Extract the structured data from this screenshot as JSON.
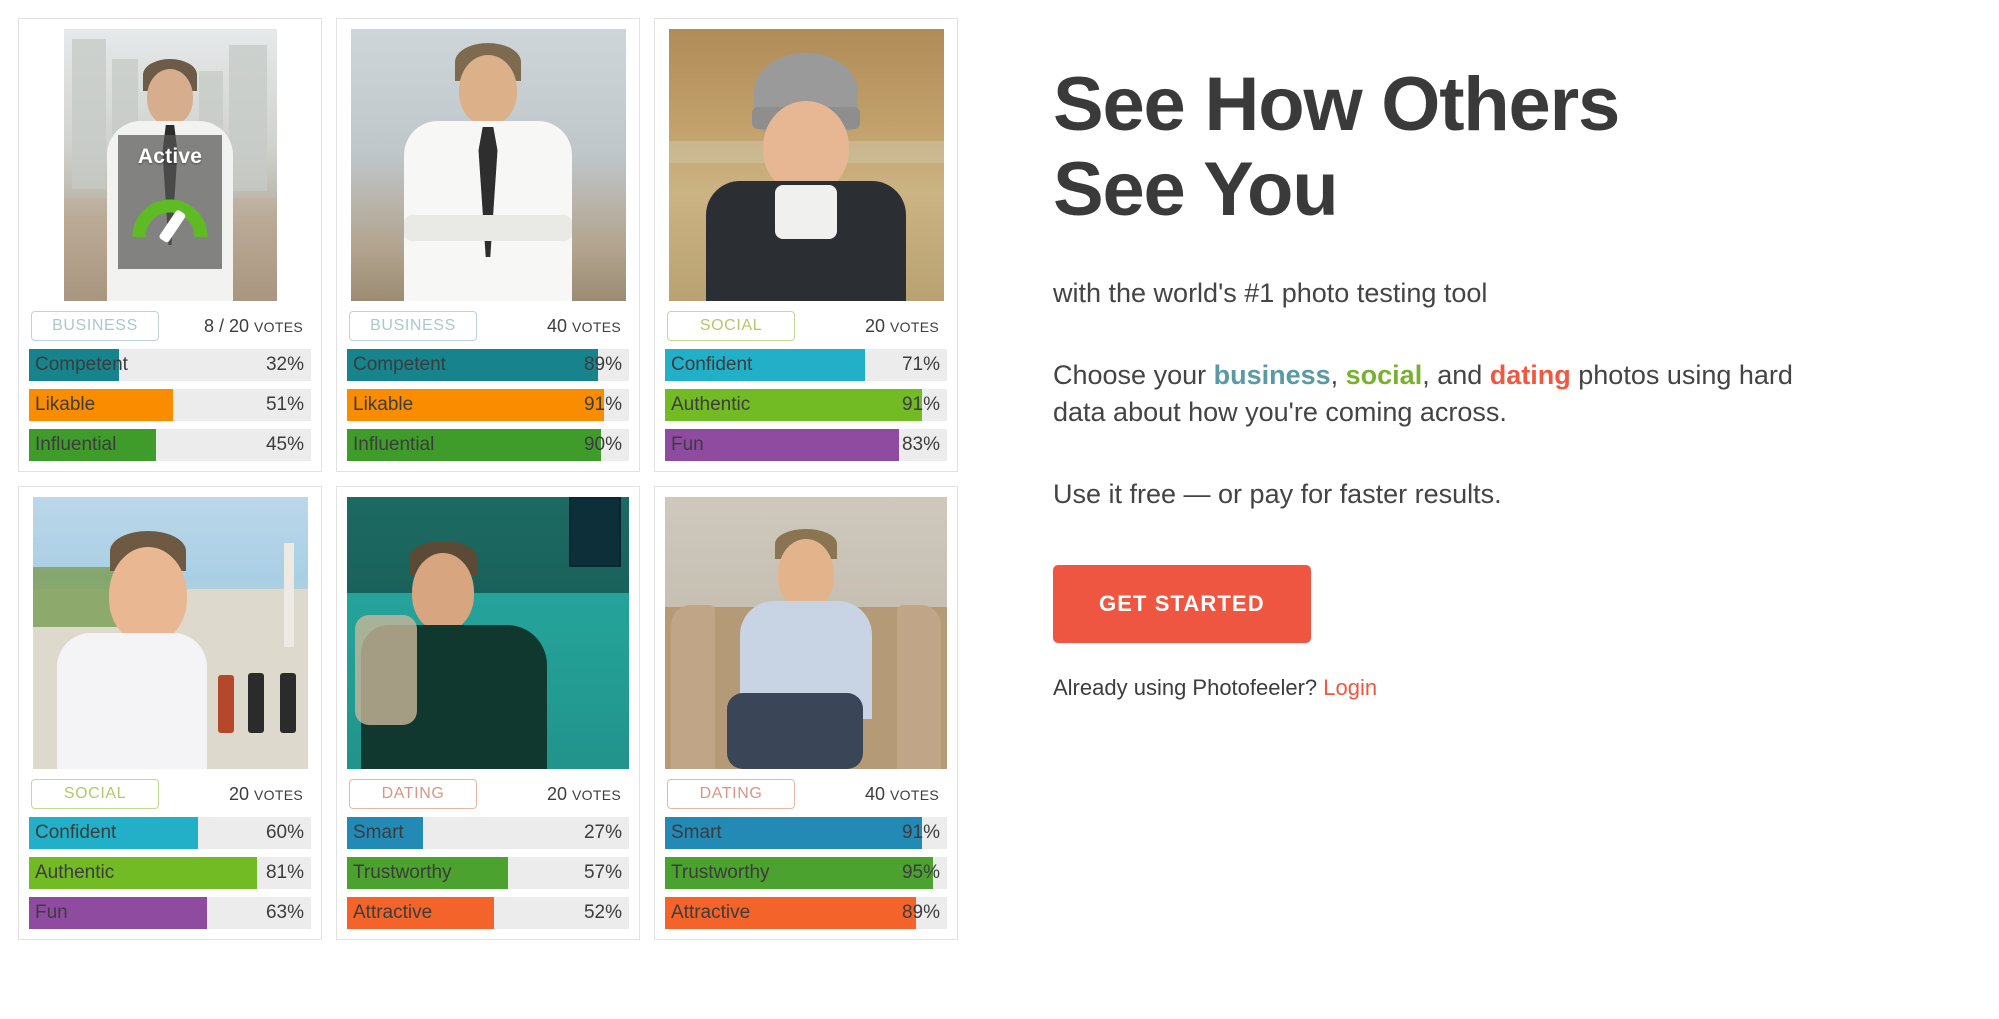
{
  "cards": [
    {
      "photo_id": "photo-man-necktie-city",
      "overlay": {
        "label": "Active",
        "icon": "gauge-icon"
      },
      "category": "BUSINESS",
      "category_key": "business",
      "votes": "8 / 20",
      "votes_word": "VOTES",
      "traits": [
        {
          "name": "Competent",
          "value": 32,
          "value_label": "32%",
          "color": "#17838c"
        },
        {
          "name": "Likable",
          "value": 51,
          "value_label": "51%",
          "color": "#fa8c00"
        },
        {
          "name": "Influential",
          "value": 45,
          "value_label": "45%",
          "color": "#3f9c2b"
        }
      ]
    },
    {
      "photo_id": "photo-man-white-shirt-tie",
      "overlay": null,
      "category": "BUSINESS",
      "category_key": "business",
      "votes": "40",
      "votes_word": "VOTES",
      "traits": [
        {
          "name": "Competent",
          "value": 89,
          "value_label": "89%",
          "color": "#17838c"
        },
        {
          "name": "Likable",
          "value": 91,
          "value_label": "91%",
          "color": "#fa8c00"
        },
        {
          "name": "Influential",
          "value": 90,
          "value_label": "90%",
          "color": "#3f9c2b"
        }
      ]
    },
    {
      "photo_id": "photo-man-beanie-outdoors",
      "overlay": null,
      "category": "SOCIAL",
      "category_key": "social",
      "votes": "20",
      "votes_word": "VOTES",
      "traits": [
        {
          "name": "Confident",
          "value": 71,
          "value_label": "71%",
          "color": "#22b0c8"
        },
        {
          "name": "Authentic",
          "value": 91,
          "value_label": "91%",
          "color": "#72bb24"
        },
        {
          "name": "Fun",
          "value": 83,
          "value_label": "83%",
          "color": "#8e4ba0"
        }
      ]
    },
    {
      "photo_id": "photo-man-white-tee-park",
      "overlay": null,
      "category": "SOCIAL",
      "category_key": "social",
      "votes": "20",
      "votes_word": "VOTES",
      "traits": [
        {
          "name": "Confident",
          "value": 60,
          "value_label": "60%",
          "color": "#22b0c8"
        },
        {
          "name": "Authentic",
          "value": 81,
          "value_label": "81%",
          "color": "#72bb24"
        },
        {
          "name": "Fun",
          "value": 63,
          "value_label": "63%",
          "color": "#8e4ba0"
        }
      ]
    },
    {
      "photo_id": "photo-man-couch-teal-light",
      "overlay": null,
      "category": "DATING",
      "category_key": "dating",
      "votes": "20",
      "votes_word": "VOTES",
      "traits": [
        {
          "name": "Smart",
          "value": 27,
          "value_label": "27%",
          "color": "#2389b5"
        },
        {
          "name": "Trustworthy",
          "value": 57,
          "value_label": "57%",
          "color": "#4ba22e"
        },
        {
          "name": "Attractive",
          "value": 52,
          "value_label": "52%",
          "color": "#f4642a"
        }
      ]
    },
    {
      "photo_id": "photo-man-blue-shirt-armchair",
      "overlay": null,
      "category": "DATING",
      "category_key": "dating",
      "votes": "40",
      "votes_word": "VOTES",
      "traits": [
        {
          "name": "Smart",
          "value": 91,
          "value_label": "91%",
          "color": "#2389b5"
        },
        {
          "name": "Trustworthy",
          "value": 95,
          "value_label": "95%",
          "color": "#4ba22e"
        },
        {
          "name": "Attractive",
          "value": 89,
          "value_label": "89%",
          "color": "#f4642a"
        }
      ]
    }
  ],
  "hero": {
    "title_line1": "See How Others",
    "title_line2": "See You",
    "subtitle": "with the world's #1 photo testing tool",
    "para1": {
      "part1": "Choose your ",
      "kw1": "business",
      "sep1": ", ",
      "kw2": "social",
      "sep2": ", and ",
      "kw3": "dating",
      "part2": " photos using hard data about how you're coming across."
    },
    "para2": "Use it free — or pay for faster results.",
    "cta_label": "GET STARTED",
    "login_prompt": "Already using Photofeeler?",
    "login_link": "Login"
  },
  "colors": {
    "accent": "#ef5641",
    "business": "#5a9aa5",
    "social": "#79b12e",
    "dating": "#ef5941",
    "gauge_green": "#5fbb24"
  }
}
